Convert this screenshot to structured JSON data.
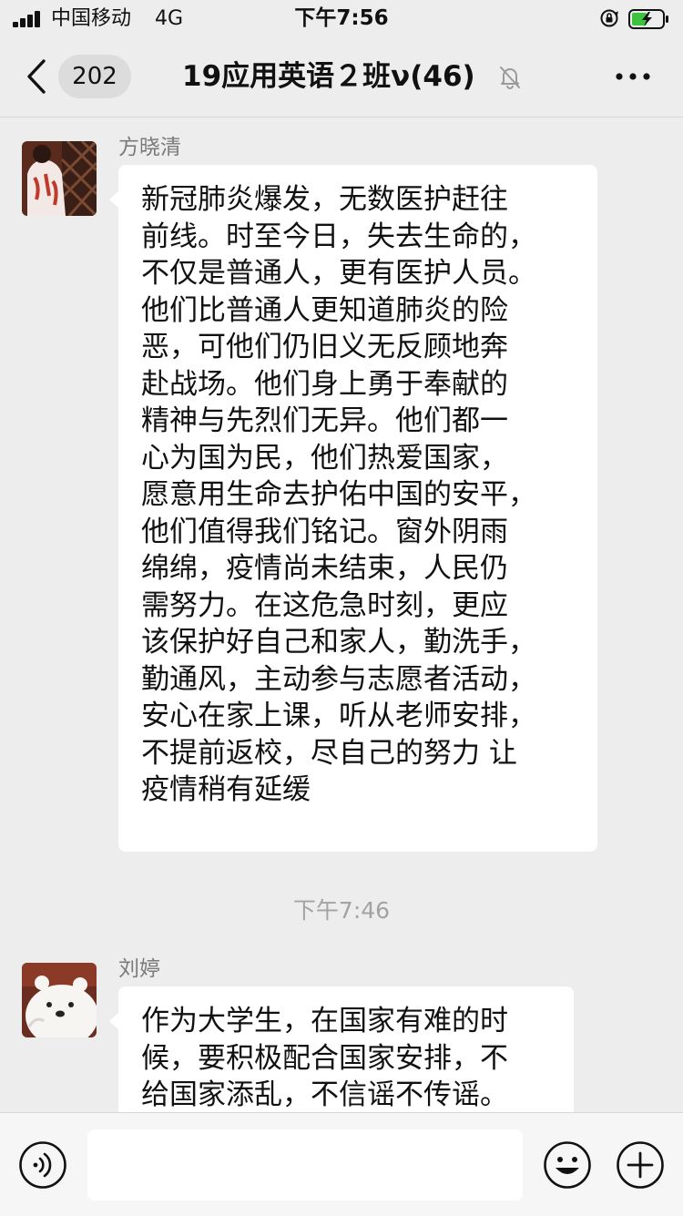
{
  "status_bar": {
    "carrier": "中国移动",
    "network": "4G",
    "time": "下午7:56",
    "icons": [
      "signal-icon",
      "rotation-lock-icon",
      "battery-charging-icon"
    ],
    "battery_color": "#3cc23c"
  },
  "header": {
    "unread_count": "202",
    "title": "19应用英语２班ν(46)",
    "icons": [
      "back-chevron-icon",
      "mute-bell-icon",
      "more-dots-icon"
    ]
  },
  "messages": [
    {
      "sender": "方晓清",
      "avatar": "avatar-fang-icon",
      "text": "新冠肺炎爆发，无数医护赶往\n前线。时至今日，失去生命的，\n不仅是普通人，更有医护人员。\n他们比普通人更知道肺炎的险\n恶，可他们仍旧义无反顾地奔\n赴战场。他们身上勇于奉献的\n精神与先烈们无异。他们都一\n心为国为民，他们热爱国家，\n愿意用生命去护佑中国的安平，\n他们值得我们铭记。窗外阴雨\n绵绵，疫情尚未结束，人民仍\n需努力。在这危急时刻，更应\n该保护好自己和家人，勤洗手，\n勤通风，主动参与志愿者活动，\n安心在家上课，听从老师安排，\n不提前返校，尽自己的努力 让\n疫情稍有延缓"
    },
    {
      "sender": "刘婷",
      "avatar": "avatar-bear-icon",
      "text": "作为大学生，在国家有难的时\n候，要积极配合国家安排，不\n给国家添乱，不信谣不传谣。"
    }
  ],
  "time_divider": "下午7:46",
  "input_bar": {
    "placeholder": "",
    "icons": [
      "voice-icon",
      "emoji-icon",
      "plus-icon"
    ]
  }
}
